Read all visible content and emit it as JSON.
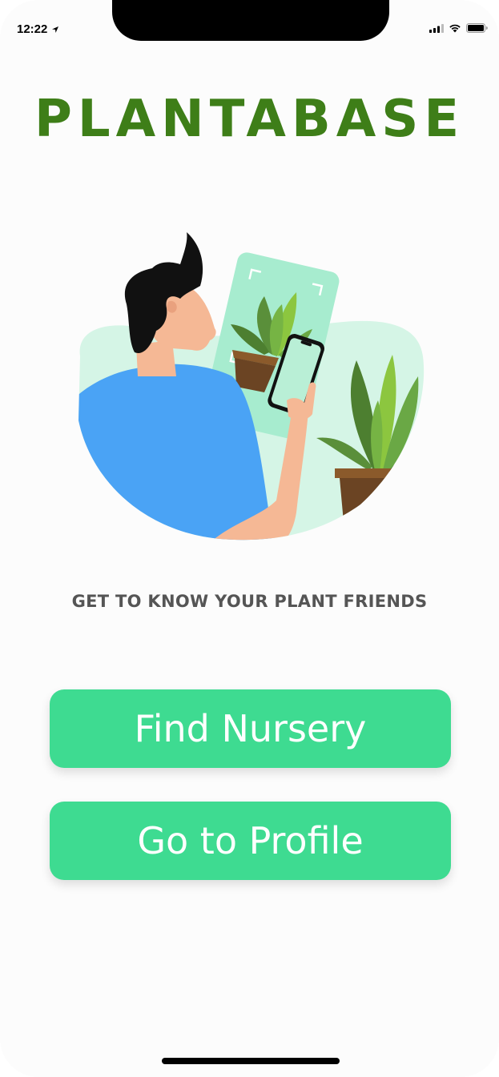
{
  "status_bar": {
    "time": "12:22",
    "icons": [
      "location-arrow-icon",
      "cellular-signal-icon",
      "wifi-icon",
      "battery-icon"
    ]
  },
  "app": {
    "title": "PLANTABASE",
    "title_color": "#3e7e18"
  },
  "illustration": {
    "name": "person-scanning-plant-illustration"
  },
  "tagline": "GET TO KNOW YOUR PLANT FRIENDS",
  "buttons": {
    "find_nursery": "Find Nursery",
    "go_to_profile": "Go to Profile",
    "color": "#3edb91"
  }
}
